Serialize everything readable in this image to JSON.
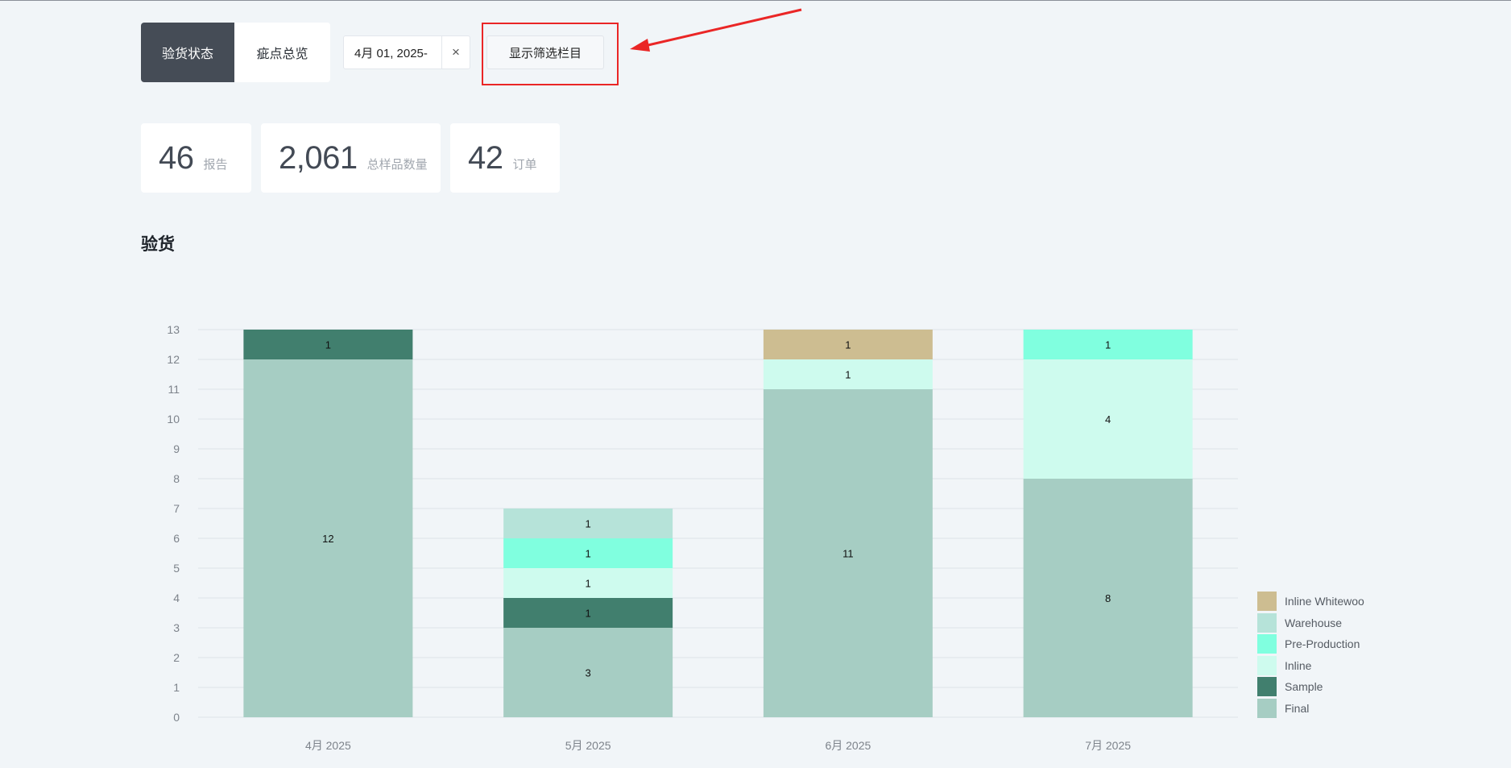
{
  "tabs": [
    {
      "label": "验货状态",
      "active": true
    },
    {
      "label": "疵点总览",
      "active": false
    }
  ],
  "date_filter": {
    "value": "4月 01, 2025-",
    "clear_icon": "×"
  },
  "filter_button": {
    "label": "显示筛选栏目"
  },
  "stats": [
    {
      "value": "46",
      "label": "报告"
    },
    {
      "value": "2,061",
      "label": "总样品数量"
    },
    {
      "value": "42",
      "label": "订单"
    }
  ],
  "section_title": "验货",
  "colors": {
    "Final": "#a6cdc3",
    "Sample": "#417f6e",
    "Inline": "#cefbee",
    "Pre-Production": "#80ffdf",
    "Warehouse": "#b6e3d9",
    "Inline Whitewoo": "#cdbd91",
    "annotation": "#ea2626"
  },
  "chart_data": {
    "type": "bar",
    "stacked": true,
    "categories": [
      "4月 2025",
      "5月 2025",
      "6月 2025",
      "7月 2025"
    ],
    "series": [
      {
        "name": "Final",
        "values": [
          12,
          3,
          11,
          8
        ]
      },
      {
        "name": "Sample",
        "values": [
          1,
          1,
          0,
          0
        ]
      },
      {
        "name": "Inline",
        "values": [
          0,
          1,
          1,
          4
        ]
      },
      {
        "name": "Pre-Production",
        "values": [
          0,
          1,
          0,
          1
        ]
      },
      {
        "name": "Warehouse",
        "values": [
          0,
          1,
          0,
          0
        ]
      },
      {
        "name": "Inline Whitewoo",
        "values": [
          0,
          0,
          1,
          0
        ]
      }
    ],
    "ylim": [
      0,
      13
    ],
    "yticks": [
      0,
      1,
      2,
      3,
      4,
      5,
      6,
      7,
      8,
      9,
      10,
      11,
      12,
      13
    ],
    "grid": true,
    "legend_position": "bottom-right",
    "legend_order": [
      "Inline Whitewoo",
      "Warehouse",
      "Pre-Production",
      "Inline",
      "Sample",
      "Final"
    ]
  }
}
